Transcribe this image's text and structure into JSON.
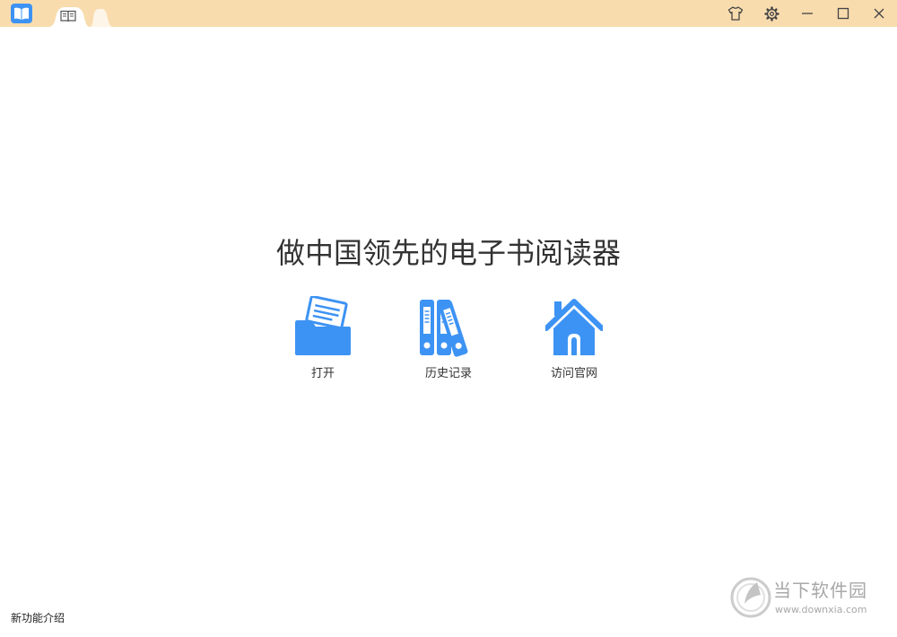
{
  "window": {
    "app_icon": "open-book-logo-icon",
    "tab_icon": "book-icon",
    "controls": [
      {
        "name": "skin-button",
        "icon": "shirt-icon"
      },
      {
        "name": "settings-button",
        "icon": "gear-icon"
      },
      {
        "name": "minimize-button",
        "icon": "minimize-icon"
      },
      {
        "name": "maximize-button",
        "icon": "maximize-icon"
      },
      {
        "name": "close-button",
        "icon": "close-icon"
      }
    ]
  },
  "main": {
    "headline": "做中国领先的电子书阅读器",
    "actions": [
      {
        "label": "打开",
        "icon": "folder-icon"
      },
      {
        "label": "历史记录",
        "icon": "binders-icon"
      },
      {
        "label": "访问官网",
        "icon": "home-icon"
      }
    ]
  },
  "footer": {
    "new_features_label": "新功能介绍"
  },
  "watermark": {
    "name": "当下软件园",
    "url": "www.downxia.com"
  },
  "colors": {
    "titlebar": "#f9dcae",
    "accent": "#3d93f3",
    "text": "#333333",
    "watermark": "#a8a8a8"
  }
}
